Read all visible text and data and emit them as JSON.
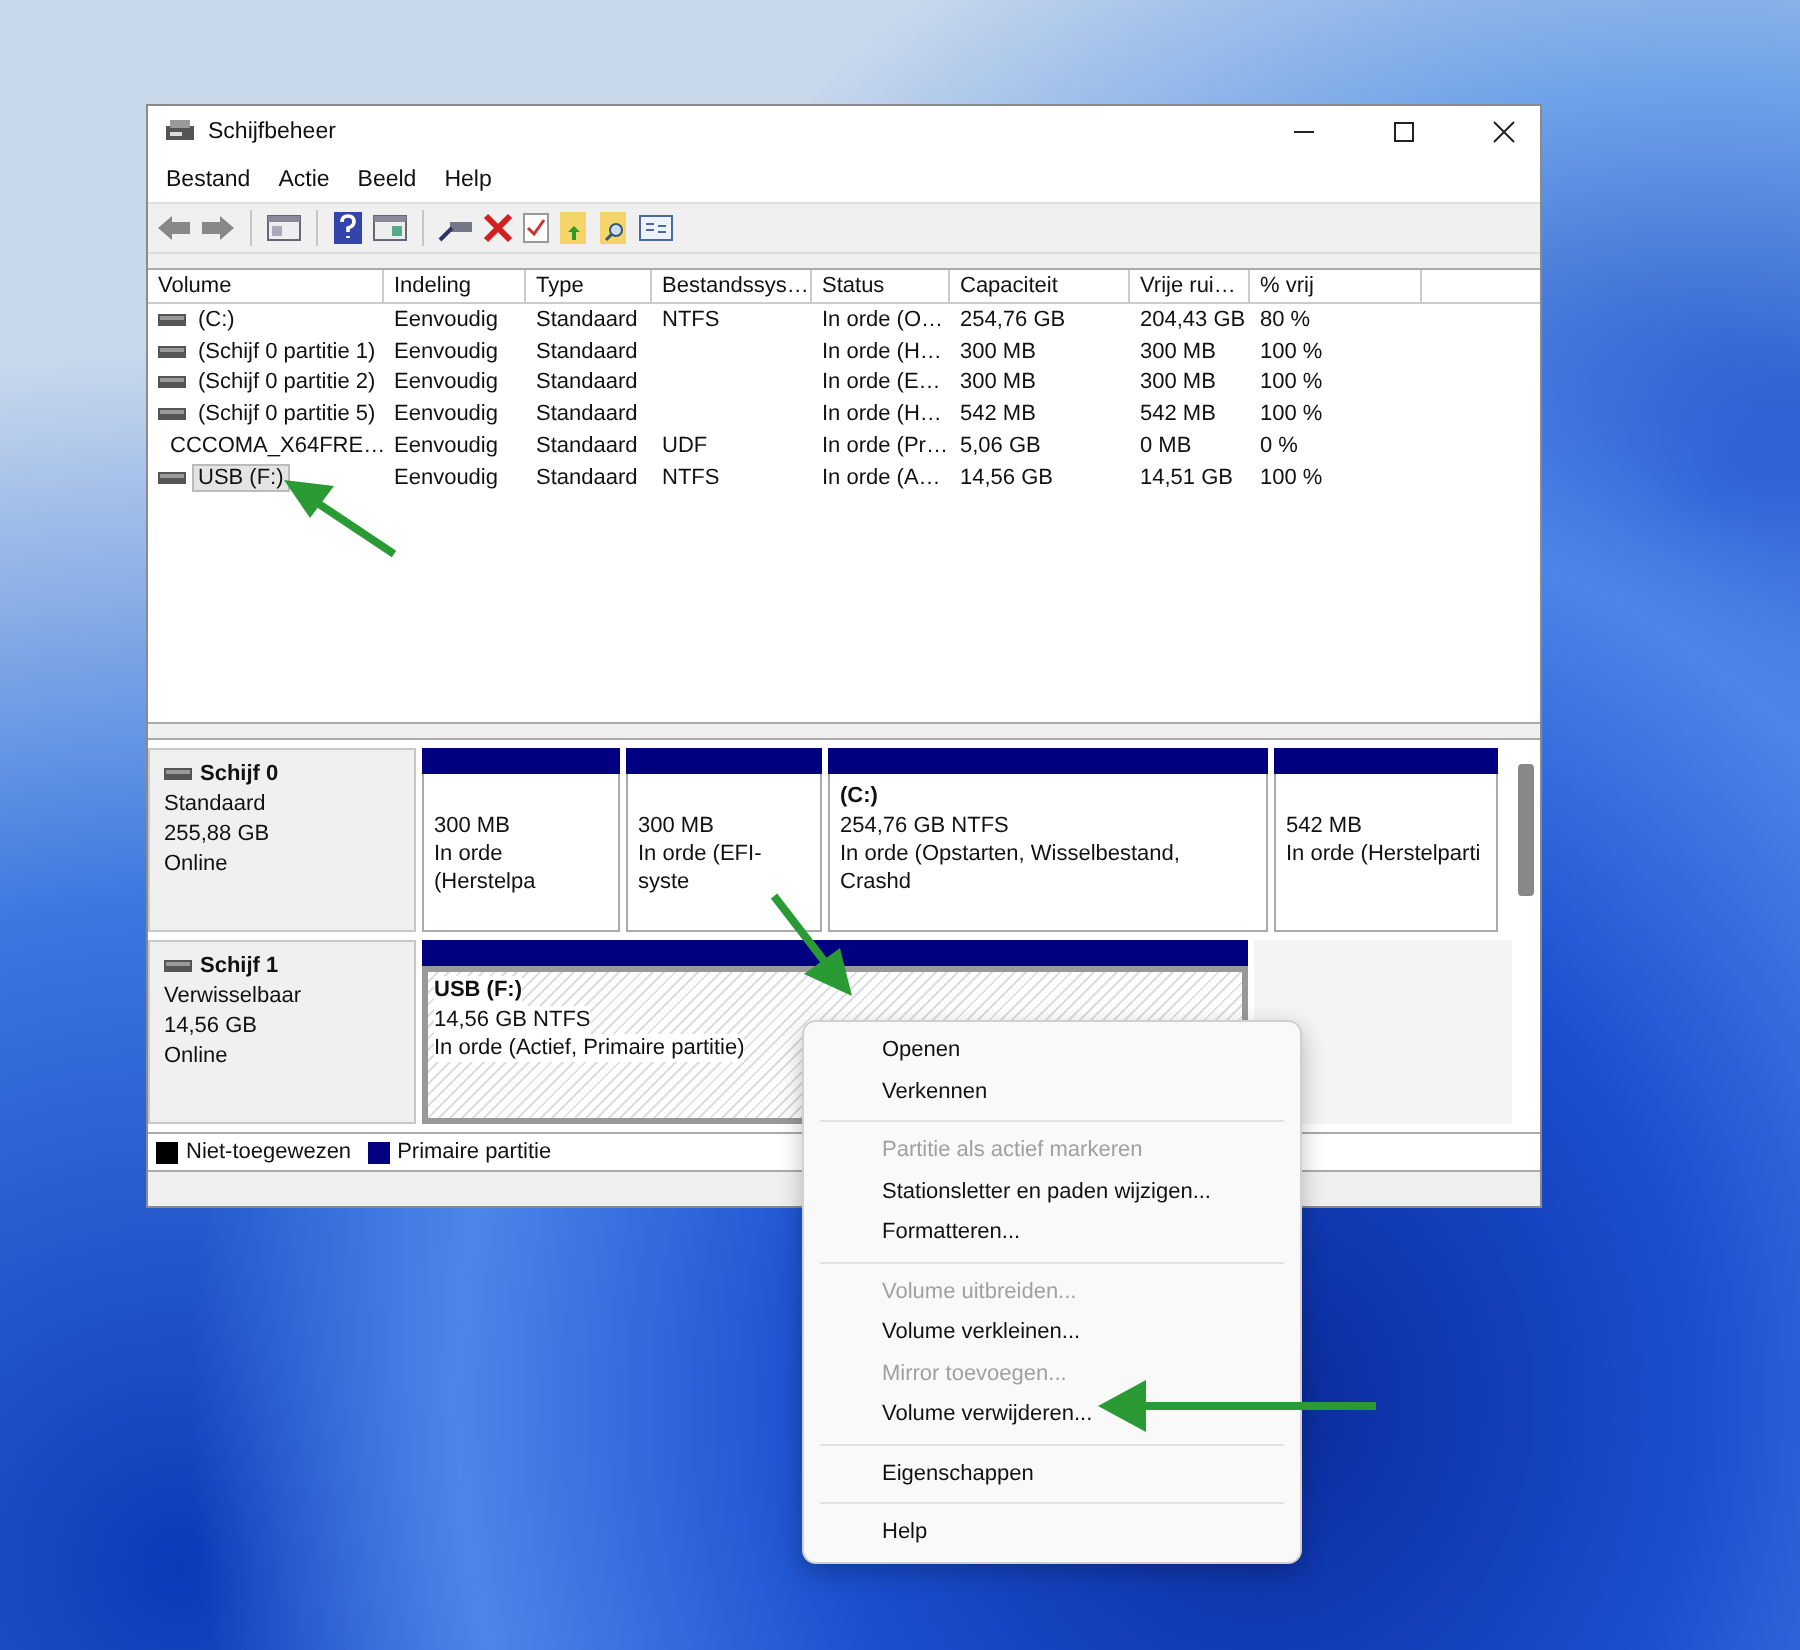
{
  "window": {
    "title": "Schijfbeheer"
  },
  "menu_bar": [
    "Bestand",
    "Actie",
    "Beeld",
    "Help"
  ],
  "table": {
    "columns": [
      "Volume",
      "Indeling",
      "Type",
      "Bestandssys…",
      "Status",
      "Capaciteit",
      "Vrije rui…",
      "% vrij"
    ],
    "rows": [
      {
        "kind": "disk",
        "selected": false,
        "cells": [
          "(C:)",
          "Eenvoudig",
          "Standaard",
          "NTFS",
          "In orde (O…",
          "254,76 GB",
          "204,43 GB",
          "80 %"
        ]
      },
      {
        "kind": "disk",
        "selected": false,
        "cells": [
          "(Schijf 0 partitie 1)",
          "Eenvoudig",
          "Standaard",
          "",
          "In orde (H…",
          "300 MB",
          "300 MB",
          "100 %"
        ]
      },
      {
        "kind": "disk",
        "selected": false,
        "cells": [
          "(Schijf 0 partitie 2)",
          "Eenvoudig",
          "Standaard",
          "",
          "In orde (E…",
          "300 MB",
          "300 MB",
          "100 %"
        ]
      },
      {
        "kind": "disk",
        "selected": false,
        "cells": [
          "(Schijf 0 partitie 5)",
          "Eenvoudig",
          "Standaard",
          "",
          "In orde (H…",
          "542 MB",
          "542 MB",
          "100 %"
        ]
      },
      {
        "kind": "cd",
        "selected": false,
        "cells": [
          "CCCOMA_X64FRE…",
          "Eenvoudig",
          "Standaard",
          "UDF",
          "In orde (Pr…",
          "5,06 GB",
          "0 MB",
          "0 %"
        ]
      },
      {
        "kind": "disk",
        "selected": true,
        "cells": [
          "USB (F:)",
          "Eenvoudig",
          "Standaard",
          "NTFS",
          "In orde (A…",
          "14,56 GB",
          "14,51 GB",
          "100 %"
        ]
      }
    ]
  },
  "disks": [
    {
      "name": "Schijf 0",
      "type": "Standaard",
      "size": "255,88 GB",
      "state": "Online",
      "partitions": [
        {
          "size": "300 MB",
          "status": "In orde (Herstelpa",
          "selected": false
        },
        {
          "size": "300 MB",
          "status": "In orde (EFI-syste",
          "selected": false
        },
        {
          "label": "(C:)",
          "size": "254,76 GB NTFS",
          "status": "In orde (Opstarten, Wisselbestand, Crashd",
          "selected": false
        },
        {
          "size": "542 MB",
          "status": "In orde (Herstelparti",
          "selected": false
        }
      ]
    },
    {
      "name": "Schijf 1",
      "type": "Verwisselbaar",
      "size": "14,56 GB",
      "state": "Online",
      "partitions": [
        {
          "label": "USB  (F:)",
          "size": "14,56 GB NTFS",
          "status": "In orde (Actief, Primaire partitie)",
          "selected": true
        }
      ]
    }
  ],
  "legend": [
    {
      "label": "Niet-toegewezen",
      "color": "#000000"
    },
    {
      "label": "Primaire partitie",
      "color": "#000080"
    }
  ],
  "context_menu": [
    {
      "kind": "item",
      "label": "Openen",
      "disabled": false
    },
    {
      "kind": "item",
      "label": "Verkennen",
      "disabled": false
    },
    {
      "kind": "separator"
    },
    {
      "kind": "item",
      "label": "Partitie als actief markeren",
      "disabled": true
    },
    {
      "kind": "item",
      "label": "Stationsletter en paden wijzigen...",
      "disabled": false
    },
    {
      "kind": "item",
      "label": "Formatteren...",
      "disabled": false
    },
    {
      "kind": "separator"
    },
    {
      "kind": "item",
      "label": "Volume uitbreiden...",
      "disabled": true
    },
    {
      "kind": "item",
      "label": "Volume verkleinen...",
      "disabled": false
    },
    {
      "kind": "item",
      "label": "Mirror toevoegen...",
      "disabled": true
    },
    {
      "kind": "item",
      "label": "Volume verwijderen...",
      "disabled": false
    },
    {
      "kind": "separator"
    },
    {
      "kind": "item",
      "label": "Eigenschappen",
      "disabled": false
    },
    {
      "kind": "separator"
    },
    {
      "kind": "item",
      "label": "Help",
      "disabled": false
    }
  ]
}
